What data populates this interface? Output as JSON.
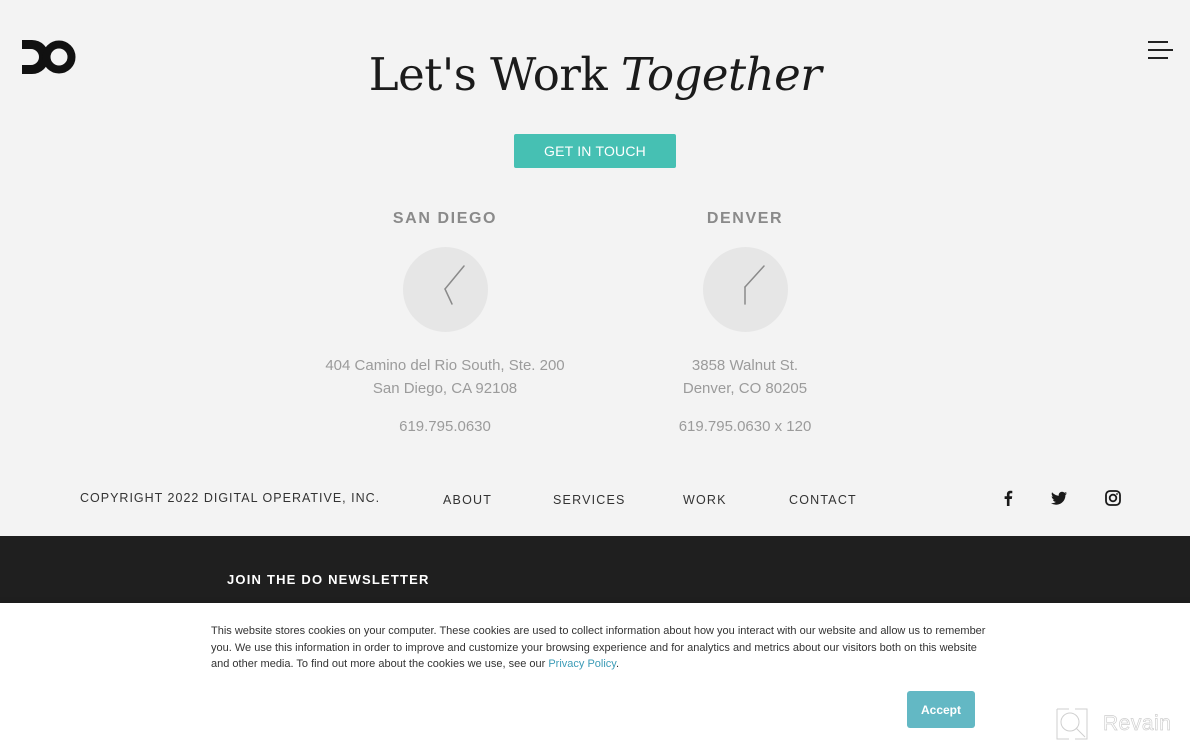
{
  "header": {
    "logo_alt": "DO",
    "headline_plain": "Let's Work ",
    "headline_italic": "Together",
    "menu_icon": "hamburger-menu-icon"
  },
  "cta": {
    "label": "GET IN TOUCH",
    "color": "#46c0b3"
  },
  "offices": [
    {
      "city": "SAN DIEGO",
      "clock_time": "4:07",
      "address_line1": "404 Camino del Rio South, Ste. 200",
      "address_line2": "San Diego, CA 92108",
      "phone": "619.795.0630"
    },
    {
      "city": "DENVER",
      "clock_time": "5:07",
      "address_line1": "3858 Walnut St.",
      "address_line2": "Denver, CO 80205",
      "phone": "619.795.0630 x 120"
    }
  ],
  "footer": {
    "copyright": "COPYRIGHT 2022 DIGITAL OPERATIVE, INC.",
    "nav": [
      "ABOUT",
      "SERVICES",
      "WORK",
      "CONTACT"
    ],
    "social": [
      "facebook-icon",
      "twitter-icon",
      "instagram-icon"
    ]
  },
  "newsletter": {
    "title": "JOIN THE DO NEWSLETTER"
  },
  "cookie_banner": {
    "text": "This website stores cookies on your computer. These cookies are used to collect information about how you interact with our website and allow us to remember you. We use this information in order to improve and customize your browsing experience and for analytics and metrics about our visitors both on this website and other media. To find out more about the cookies we use, see our ",
    "link_label": "Privacy Policy",
    "text_end": ".",
    "accept_label": "Accept",
    "accent": "#63b8c4"
  },
  "watermark": {
    "label": "Revain"
  }
}
